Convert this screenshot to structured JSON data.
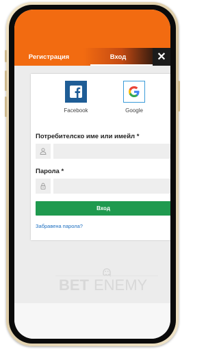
{
  "tabs": {
    "register": "Регистрация",
    "login": "Вход",
    "close_symbol": "✕"
  },
  "social": {
    "facebook": "Facebook",
    "google": "Google"
  },
  "form": {
    "username_label": "Потребителско име или имейл *",
    "password_label": "Парола *",
    "username_value": "",
    "password_value": "",
    "submit_label": "Вход",
    "forgot_label": "Забравена парола?"
  },
  "watermark": {
    "text_bet": "BET",
    "text_enemy": "ENEMY"
  },
  "colors": {
    "accent": "#f26b11",
    "submit": "#1f9a4f",
    "link": "#1d6fc0",
    "facebook": "#1f5d96"
  },
  "icons": [
    "facebook-icon",
    "google-icon",
    "user-icon",
    "lock-icon",
    "close-icon",
    "ghost-icon"
  ]
}
